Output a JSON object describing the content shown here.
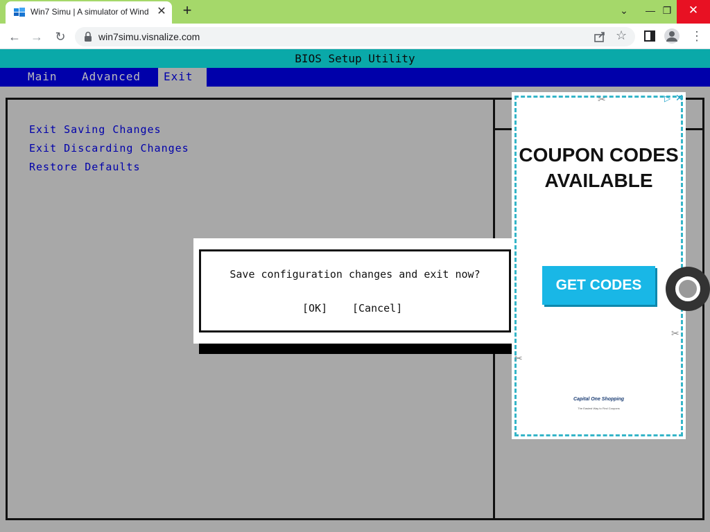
{
  "browser": {
    "tab_title": "Win7 Simu | A simulator of Wind",
    "url": "win7simu.visnalize.com"
  },
  "bios": {
    "title": "BIOS Setup Utility",
    "tabs": [
      {
        "label": "Main"
      },
      {
        "label": "Advanced"
      },
      {
        "label": "Exit",
        "active": true
      }
    ],
    "options": [
      {
        "label": "Exit Saving Changes"
      },
      {
        "label": "Exit Discarding Changes"
      },
      {
        "label": "Restore Defaults"
      }
    ]
  },
  "dialog": {
    "message": "Save configuration changes and exit now?",
    "ok_label": "[OK]",
    "cancel_label": "[Cancel]"
  },
  "ad": {
    "headline": "COUPON CODES\nAVAILABLE",
    "cta": "GET CODES",
    "brand": "Capital One Shopping",
    "tagline": "The Easiest Way to Find Coupons",
    "accent_color": "#19b7e6",
    "border_color": "#35b5c8"
  },
  "colors": {
    "bios_title_bg": "#0aa9a9",
    "bios_menubar_bg": "#0000aa",
    "bios_body_bg": "#a8a8a8",
    "browser_tab_strip": "#a5d86a"
  }
}
